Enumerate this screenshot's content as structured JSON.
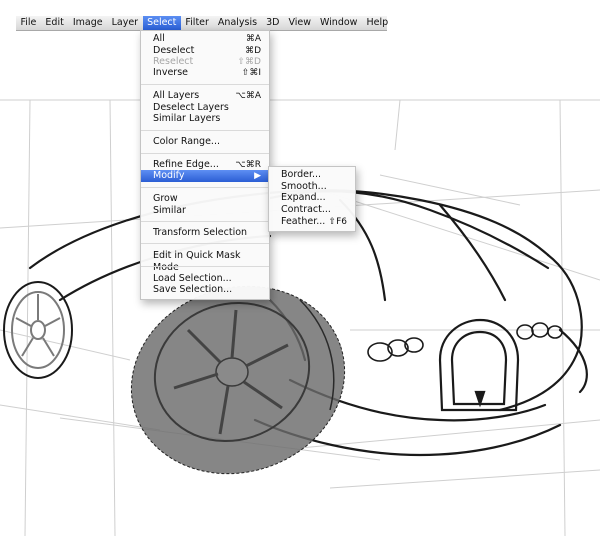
{
  "menubar": {
    "items": [
      {
        "label": "File"
      },
      {
        "label": "Edit"
      },
      {
        "label": "Image"
      },
      {
        "label": "Layer"
      },
      {
        "label": "Select"
      },
      {
        "label": "Filter"
      },
      {
        "label": "Analysis"
      },
      {
        "label": "3D"
      },
      {
        "label": "View"
      },
      {
        "label": "Window"
      },
      {
        "label": "Help"
      }
    ]
  },
  "select_menu": {
    "items": [
      {
        "label": "All",
        "shortcut": "⌘A"
      },
      {
        "label": "Deselect",
        "shortcut": "⌘D"
      },
      {
        "label": "Reselect",
        "shortcut": "⇧⌘D"
      },
      {
        "label": "Inverse",
        "shortcut": "⇧⌘I"
      },
      {
        "label": "All Layers",
        "shortcut": "⌥⌘A"
      },
      {
        "label": "Deselect Layers",
        "shortcut": ""
      },
      {
        "label": "Similar Layers",
        "shortcut": ""
      },
      {
        "label": "Color Range...",
        "shortcut": ""
      },
      {
        "label": "Refine Edge...",
        "shortcut": "⌥⌘R"
      },
      {
        "label": "Modify",
        "shortcut": "▶"
      },
      {
        "label": "Grow",
        "shortcut": ""
      },
      {
        "label": "Similar",
        "shortcut": ""
      },
      {
        "label": "Transform Selection",
        "shortcut": ""
      },
      {
        "label": "Edit in Quick Mask Mode",
        "shortcut": ""
      },
      {
        "label": "Load Selection...",
        "shortcut": ""
      },
      {
        "label": "Save Selection...",
        "shortcut": ""
      }
    ]
  },
  "modify_submenu": {
    "items": [
      {
        "label": "Border...",
        "shortcut": ""
      },
      {
        "label": "Smooth...",
        "shortcut": ""
      },
      {
        "label": "Expand...",
        "shortcut": ""
      },
      {
        "label": "Contract...",
        "shortcut": ""
      },
      {
        "label": "Feather...",
        "shortcut": "⇧F6"
      }
    ]
  },
  "colors": {
    "highlight": "#3a6ee0",
    "selection_fill": "#6b6b6b",
    "outline": "#1a1a1a",
    "guide": "#c8c8c8"
  }
}
